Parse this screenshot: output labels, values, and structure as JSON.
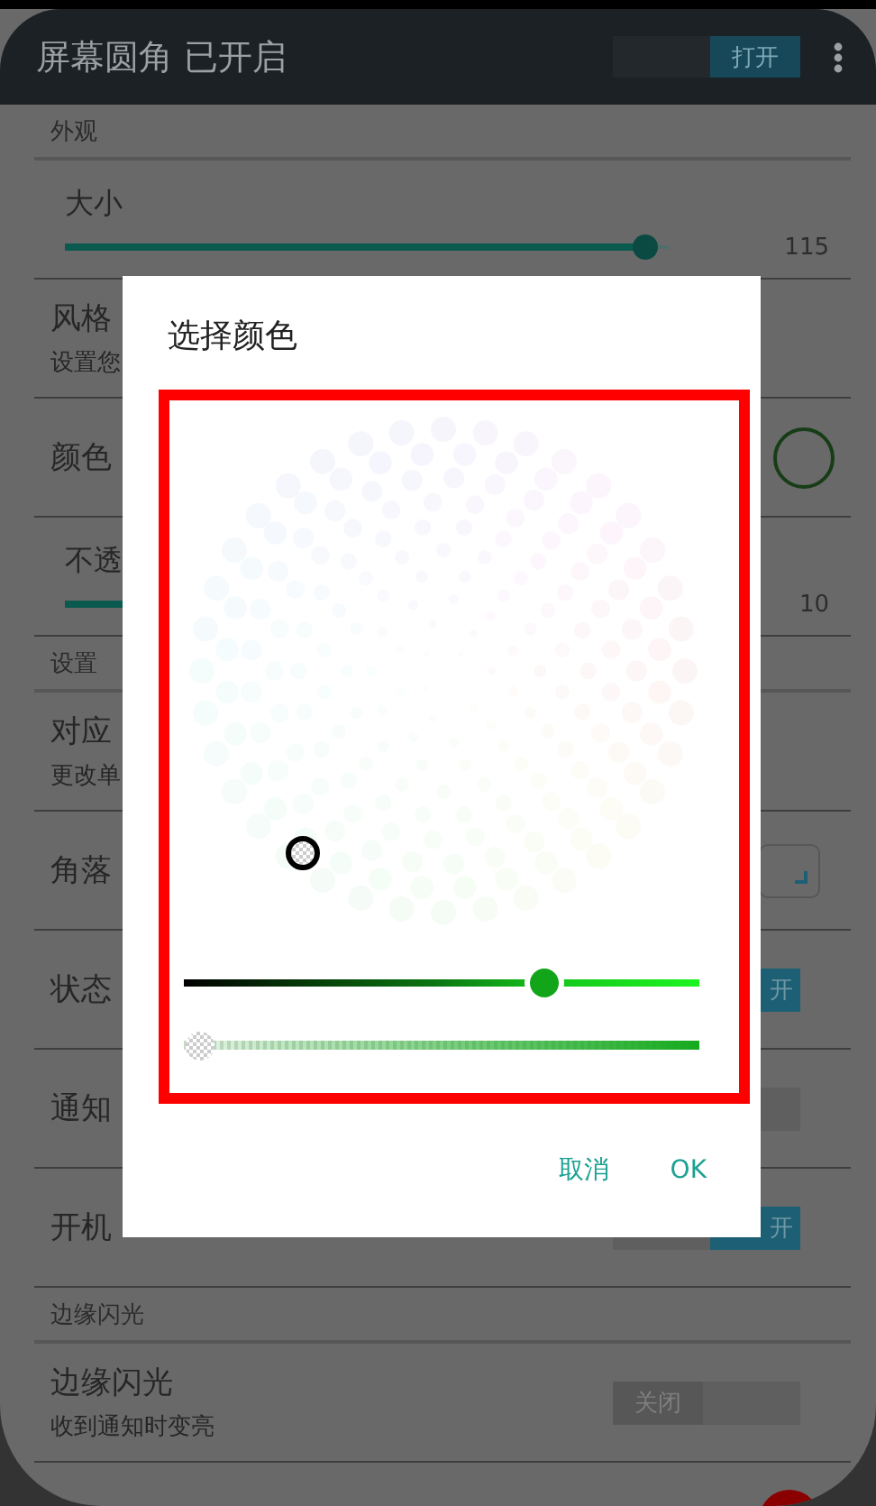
{
  "app_bar": {
    "title": "屏幕圆角 已开启",
    "switch": {
      "label": "打开",
      "on": true
    }
  },
  "sections": [
    {
      "header": "外观",
      "items": [
        {
          "kind": "slider",
          "title": "大小",
          "level": 0.96,
          "value": "115"
        },
        {
          "kind": "text",
          "title": "风格",
          "subtitle": "设置您"
        },
        {
          "kind": "color",
          "title": "颜色"
        },
        {
          "kind": "slider",
          "title": "不透",
          "value": "10"
        }
      ]
    },
    {
      "header": "设置",
      "items": [
        {
          "kind": "text",
          "title": "对应",
          "subtitle": "更改单"
        },
        {
          "kind": "dropdown",
          "title": "角落"
        },
        {
          "kind": "switch",
          "title": "状态",
          "on": true,
          "label": "开"
        },
        {
          "kind": "switch",
          "title": "通知",
          "on": false
        },
        {
          "kind": "switch",
          "title": "开机",
          "on": true,
          "label": "开"
        }
      ]
    },
    {
      "header": "边缘闪光",
      "items": [
        {
          "kind": "switch",
          "title": "边缘闪光",
          "subtitle": "收到通知时变亮",
          "on": false,
          "label": "关闭"
        }
      ]
    }
  ],
  "dialog": {
    "title": "选择颜色",
    "lightness": {
      "level": 0.7
    },
    "alpha": {
      "level": 0.03
    },
    "buttons": [
      "取消",
      "OK"
    ]
  }
}
